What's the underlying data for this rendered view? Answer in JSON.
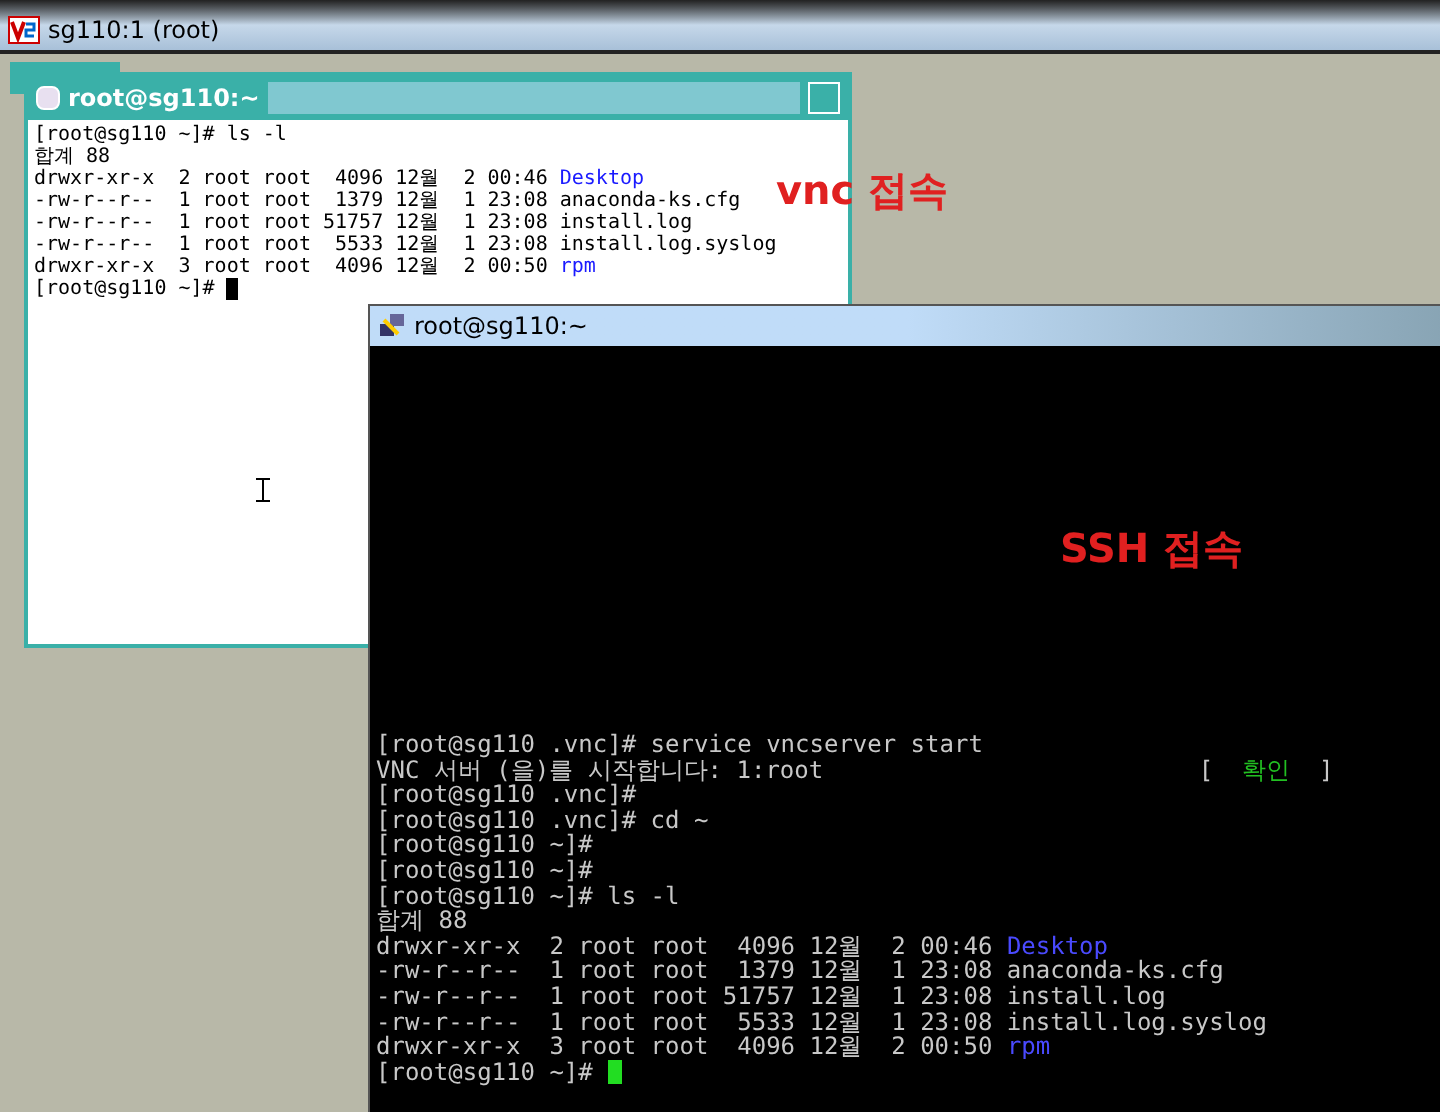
{
  "viewer": {
    "title": "sg110:1 (root)"
  },
  "xterm": {
    "title": "root@sg110:~",
    "lines": [
      [
        {
          "kind": "plain",
          "text": "[root@sg110 ~]# ls -l"
        }
      ],
      [
        {
          "kind": "plain",
          "text": "합계 88"
        }
      ],
      [
        {
          "kind": "plain",
          "text": "drwxr-xr-x  2 root root  4096 12월  2 00:46 "
        },
        {
          "kind": "dir",
          "text": "Desktop"
        }
      ],
      [
        {
          "kind": "plain",
          "text": "-rw-r--r--  1 root root  1379 12월  1 23:08 anaconda-ks.cfg"
        }
      ],
      [
        {
          "kind": "plain",
          "text": "-rw-r--r--  1 root root 51757 12월  1 23:08 install.log"
        }
      ],
      [
        {
          "kind": "plain",
          "text": "-rw-r--r--  1 root root  5533 12월  1 23:08 install.log.syslog"
        }
      ],
      [
        {
          "kind": "plain",
          "text": "drwxr-xr-x  3 root root  4096 12월  2 00:50 "
        },
        {
          "kind": "dir",
          "text": "rpm"
        }
      ],
      [
        {
          "kind": "plain",
          "text": "[root@sg110 ~]# "
        },
        {
          "kind": "cursor"
        }
      ]
    ]
  },
  "putty": {
    "title": "root@sg110:~",
    "lines": [
      [
        {
          "kind": "plain",
          "text": "[root@sg110 .vnc]# service vncserver start"
        }
      ],
      [
        {
          "kind": "plain",
          "text": "VNC 서버 (을)를 시작합니다: 1:root                          [  "
        },
        {
          "kind": "ok",
          "text": "확인"
        },
        {
          "kind": "plain",
          "text": "  ]"
        }
      ],
      [
        {
          "kind": "plain",
          "text": "[root@sg110 .vnc]#"
        }
      ],
      [
        {
          "kind": "plain",
          "text": "[root@sg110 .vnc]# cd ~"
        }
      ],
      [
        {
          "kind": "plain",
          "text": "[root@sg110 ~]#"
        }
      ],
      [
        {
          "kind": "plain",
          "text": "[root@sg110 ~]#"
        }
      ],
      [
        {
          "kind": "plain",
          "text": "[root@sg110 ~]# ls -l"
        }
      ],
      [
        {
          "kind": "plain",
          "text": "합계 88"
        }
      ],
      [
        {
          "kind": "plain",
          "text": "drwxr-xr-x  2 root root  4096 12월  2 00:46 "
        },
        {
          "kind": "dir",
          "text": "Desktop"
        }
      ],
      [
        {
          "kind": "plain",
          "text": "-rw-r--r--  1 root root  1379 12월  1 23:08 anaconda-ks.cfg"
        }
      ],
      [
        {
          "kind": "plain",
          "text": "-rw-r--r--  1 root root 51757 12월  1 23:08 install.log"
        }
      ],
      [
        {
          "kind": "plain",
          "text": "-rw-r--r--  1 root root  5533 12월  1 23:08 install.log.syslog"
        }
      ],
      [
        {
          "kind": "plain",
          "text": "drwxr-xr-x  3 root root  4096 12월  2 00:50 "
        },
        {
          "kind": "dir",
          "text": "rpm"
        }
      ],
      [
        {
          "kind": "plain",
          "text": "[root@sg110 ~]# "
        },
        {
          "kind": "cursor"
        }
      ]
    ]
  },
  "annotations": [
    {
      "text": "vnc 접속"
    },
    {
      "text": "SSH 접속"
    }
  ]
}
